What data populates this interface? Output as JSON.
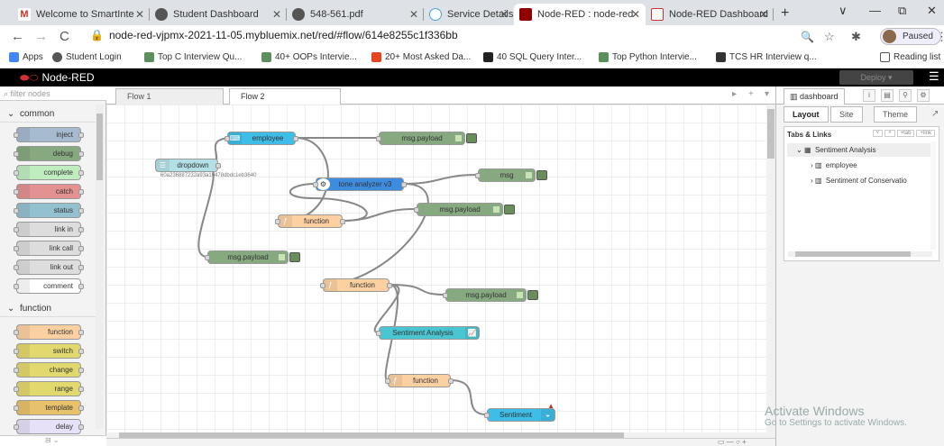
{
  "browser": {
    "tabs": [
      {
        "label": "Welcome to SmartInte",
        "icon": "gmail-icon"
      },
      {
        "label": "Student Dashboard",
        "icon": "globe-icon"
      },
      {
        "label": "548-561.pdf",
        "icon": "globe-icon"
      },
      {
        "label": "Service Details - IBM C",
        "icon": "ibm-cloud-icon"
      },
      {
        "label": "Node-RED : node-red",
        "icon": "node-red-icon"
      },
      {
        "label": "Node-RED Dashboard",
        "icon": "node-red-icon"
      }
    ],
    "new_tab": "+",
    "window_controls": {
      "dropdown": "∨",
      "minimize": "—",
      "restore": "⧉",
      "close": "✕"
    },
    "url": "node-red-vjpmx-2021-11-05.mybluemix.net/red/#flow/614e8255c1f336bb",
    "profile_status": "Paused",
    "bookmarks": [
      "Apps",
      "Student Login",
      "Top C Interview Qu...",
      "40+ OOPs Intervie...",
      "20+ Most Asked Da...",
      "40 SQL Query Inter...",
      "Top Python Intervie...",
      "TCS HR Interview q..."
    ],
    "reading_list": "Reading list"
  },
  "nodered": {
    "title": "Node-RED",
    "deploy_label": "Deploy",
    "filter_placeholder": "filter nodes",
    "palette": {
      "common_label": "common",
      "common": [
        {
          "label": "inject",
          "color": "#a6bbcf"
        },
        {
          "label": "debug",
          "color": "#87a980"
        },
        {
          "label": "complete",
          "color": "#c0edc0"
        },
        {
          "label": "catch",
          "color": "#e49191"
        },
        {
          "label": "status",
          "color": "#94c1d0"
        },
        {
          "label": "link in",
          "color": "#dddddd"
        },
        {
          "label": "link call",
          "color": "#dddddd"
        },
        {
          "label": "link out",
          "color": "#dddddd"
        },
        {
          "label": "comment",
          "color": "#ffffff"
        }
      ],
      "function_label": "function",
      "function": [
        {
          "label": "function",
          "color": "#fdd0a2"
        },
        {
          "label": "switch",
          "color": "#e2d96e"
        },
        {
          "label": "change",
          "color": "#e2d96e"
        },
        {
          "label": "range",
          "color": "#e2d96e"
        },
        {
          "label": "template",
          "color": "#e7c26b"
        },
        {
          "label": "delay",
          "color": "#e6e0f8"
        }
      ]
    },
    "flow_tabs": [
      "Flow 1",
      "Flow 2"
    ],
    "flow": {
      "dropdown_label": "dropdown",
      "dropdown_id": "60a236887232a93a10478dbdc1eb3640",
      "employee_label": "employee",
      "tone_label": "tone analyzer v3",
      "function_label": "function",
      "msg_label": "msg",
      "msg_payload_label": "msg.payload",
      "sentiment_analysis_label": "Sentiment Analysis",
      "sentiment_label": "Sentiment"
    },
    "zoom_controls": "▭ — ○ +",
    "sidebar": {
      "tab": "dashboard",
      "subtabs": [
        "Layout",
        "Site",
        "Theme"
      ],
      "panel_title": "Tabs & Links",
      "panel_buttons": [
        "˅",
        "˄",
        "+tab",
        "+link"
      ],
      "tree_root": "Sentiment Analysis",
      "tree_children": [
        "employee",
        "Sentiment of Conservatio"
      ]
    }
  },
  "windows_watermark": {
    "line1": "Activate Windows",
    "line2": "Go to Settings to activate Windows."
  }
}
